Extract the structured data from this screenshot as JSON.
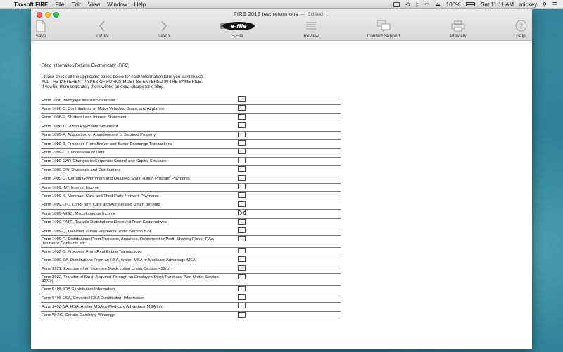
{
  "menubar": {
    "app_name": "Taxsoft FIRE",
    "menus": [
      "File",
      "Edit",
      "View",
      "Window",
      "Help"
    ],
    "battery": "100%",
    "clock": "Sat 11:11 AM",
    "user": "mickey"
  },
  "window": {
    "title": "FIRE 2015 test return one",
    "title_suffix": "— Edited ⌄"
  },
  "toolbar": {
    "save": "Save",
    "prev": "< Prev",
    "next": "Next >",
    "efile_logo": "e-file",
    "efile": "E-File",
    "review": "Review",
    "contact": "Contact Support",
    "preview": "Preview",
    "help": "Help"
  },
  "document": {
    "heading": "Filing Information Returns Electronically (FIRE)",
    "instructions": [
      "Please check all the applicable boxes below for each Information form you want to use.",
      "ALL THE DIFFERENT TYPES OF FORMS MUST BE ENTERED IN THE SAME FILE.",
      "If you file them separately there will be an extra charge for e-filing."
    ],
    "forms": [
      {
        "label": "Form 1098, Mortgage Interest Statement",
        "checked": false
      },
      {
        "label": "Form 1098-C, Contributions of Motor Vehicles, Boats, and Airplanes",
        "checked": false
      },
      {
        "label": "Form 1098-E, Student Loan Interest Statement",
        "checked": false
      },
      {
        "label": "Form 1098-T, Tuition Payments Statement",
        "checked": false
      },
      {
        "label": "Form 1099-A, Acquisition or Abandonment of Secured Property",
        "checked": false
      },
      {
        "label": "Form 1099-B, Proceeds From Broker and Barter Exchange Transactions",
        "checked": false
      },
      {
        "label": "Form 1099-C, Cancellation of Debt",
        "checked": false
      },
      {
        "label": "Form 1099-CAP, Changes in Corporate Control and Capital Structure",
        "checked": false
      },
      {
        "label": "Form 1099-DIV, Dividends and Distributions",
        "checked": false
      },
      {
        "label": "Form 1099-G, Certain Government and Qualified State Tuition Program Payments",
        "checked": false
      },
      {
        "label": "Form 1099-INT, Interest Income",
        "checked": false
      },
      {
        "label": "Form 1099-K, Merchant Card and Third Party Network Payments",
        "checked": false
      },
      {
        "label": "Form 1099-LTC, Long-Term Care and Accelerated Death Benefits",
        "checked": false
      },
      {
        "label": "Form 1099-MISC, Miscellaneous Income",
        "checked": true
      },
      {
        "label": "Form 1099-PATR, Taxable Distributions Received From Cooperatives",
        "checked": false
      },
      {
        "label": "Form 1099-Q, Qualified Tuition Payments under Section 529",
        "checked": false
      },
      {
        "label": "Form 1099-R, Distributions From Pensions, Annuities, Retirement or Profit-Sharing Plans, IRAs, Insurance Contracts, etc.",
        "checked": false
      },
      {
        "label": "Form 1099-S, Proceeds From Real Estate Transactions",
        "checked": false
      },
      {
        "label": "Form 1099-SA, Distributions From an HSA, Archer MSA or Medicare Advantage MSA",
        "checked": false
      },
      {
        "label": "Form 3921, Exercise of an Incentive Stock option Under Section 422(b)",
        "checked": false
      },
      {
        "label": "Form 3922, Transfer of Stock Acquired Through an Employee Stock Purchase Plan Under Section 423(c)",
        "checked": false
      },
      {
        "label": "Form 5498, IRA Contribution Information",
        "checked": false
      },
      {
        "label": "Form 5498-ESA, Coverdell ESA Contribution Information",
        "checked": false
      },
      {
        "label": "Form 5498-SA, HSA, Archer MSA or Medicare Advantage MSA Info.",
        "checked": false
      },
      {
        "label": "Form W-2G, Certain Gambling Winnings",
        "checked": false
      }
    ]
  }
}
